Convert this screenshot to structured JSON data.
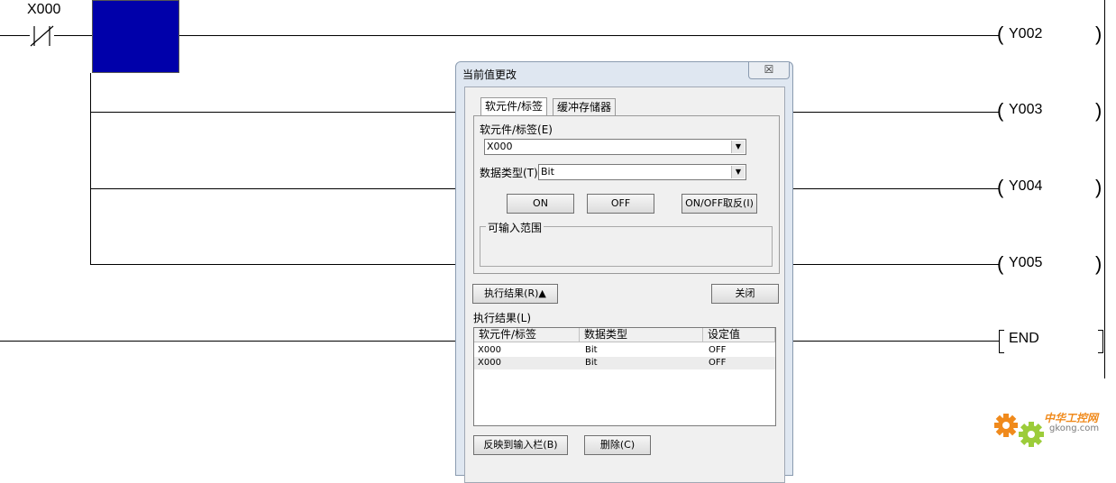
{
  "ladder": {
    "contact_label": "X000",
    "coils": [
      "Y002",
      "Y003",
      "Y004",
      "Y005"
    ],
    "end_label": "END"
  },
  "dialog": {
    "title": "当前值更改",
    "close_glyph": "☒",
    "tabs": [
      {
        "label": "软元件/标签",
        "active": true
      },
      {
        "label": "缓冲存储器",
        "active": false
      }
    ],
    "device_label": "软元件/标签(E)",
    "device_value": "X000",
    "datatype_label": "数据类型(T)",
    "datatype_value": "Bit",
    "on_button": "ON",
    "off_button": "OFF",
    "toggle_button": "ON/OFF取反(I)",
    "range_group_title": "可输入范围",
    "result_toggle_button": "执行结果(R)▲",
    "close_button": "关闭",
    "result_label": "执行结果(L)",
    "result_columns": [
      "软元件/标签",
      "数据类型",
      "设定值"
    ],
    "result_rows": [
      [
        "X000",
        "Bit",
        "OFF"
      ],
      [
        "X000",
        "Bit",
        "OFF"
      ]
    ],
    "reflect_button": "反映到输入栏(B)",
    "delete_button": "删除(C)"
  },
  "watermark": {
    "text_cn": "中华工控网",
    "text_url": "gkong.com"
  },
  "colors": {
    "selection_block": "#0000aa",
    "dialog_frame": "#dfe7f1",
    "watermark_orange": "#f08a1c"
  }
}
